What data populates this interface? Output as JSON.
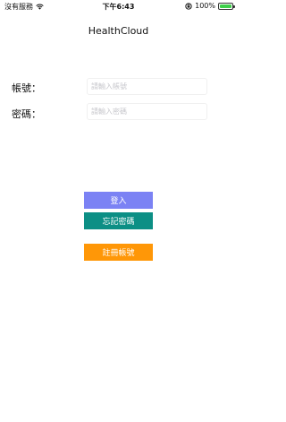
{
  "status_bar": {
    "carrier": "沒有服務",
    "time": "下午6:43",
    "battery": "100%",
    "battery_level": 1.0,
    "icons": [
      "wifi-icon",
      "orientation-lock-icon",
      "battery-icon"
    ]
  },
  "nav": {
    "title": "HealthCloud"
  },
  "form": {
    "account_label": "帳號：",
    "account_placeholder": "請輸入帳號",
    "account_value": "",
    "password_label": "密碼：",
    "password_placeholder": "請輸入密碼",
    "password_value": ""
  },
  "buttons": {
    "login": "登入",
    "forgot": "忘記密碼",
    "register": "註冊帳號"
  },
  "colors": {
    "login": "#7b82f4",
    "forgot": "#0c8f85",
    "register": "#ff9707",
    "battery": "#3ecf4a"
  }
}
